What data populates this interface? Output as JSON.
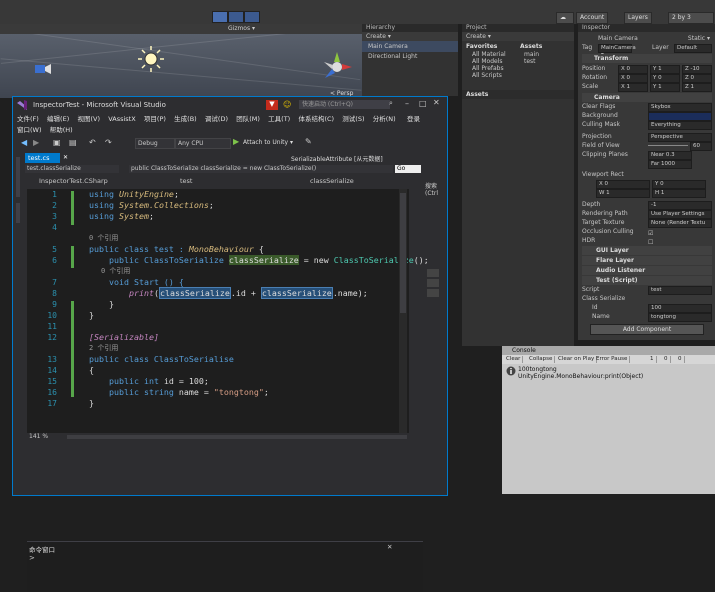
{
  "unity": {
    "top": {
      "account": "Account",
      "layers": "Layers",
      "layout": "2 by 3"
    },
    "scene": {
      "toolbar_label": "Gizmos ▾",
      "persp": "< Persp"
    },
    "hierarchy": {
      "tab": "Hierarchy",
      "create": "Create ▾",
      "search": "Q▾All",
      "items": [
        "Main Camera",
        "Directional Light"
      ]
    },
    "project": {
      "tab": "Project",
      "create": "Create ▾",
      "favorites": "Favorites",
      "fav_items": [
        "All Material",
        "All Models",
        "All Prefabs",
        "All Scripts"
      ],
      "assets_label": "Assets",
      "assets_title": "Assets",
      "assets_items": [
        "main",
        "test"
      ]
    },
    "inspector": {
      "tab": "Inspector",
      "object_name": "Main Camera",
      "static": "Static ▾",
      "tag_label": "Tag",
      "tag_value": "MainCamera ▾",
      "layer_label": "Layer",
      "layer_value": "Default",
      "transform": "Transform",
      "position": {
        "label": "Position",
        "x": "X  0",
        "y": "Y  1",
        "z": "Z  -10"
      },
      "rotation": {
        "label": "Rotation",
        "x": "X  0",
        "y": "Y  0",
        "z": "Z  0"
      },
      "scale": {
        "label": "Scale",
        "x": "X  1",
        "y": "Y  1",
        "z": "Z  1"
      },
      "camera": "Camera",
      "clear_flags": {
        "label": "Clear Flags",
        "value": "Skybox"
      },
      "background": {
        "label": "Background"
      },
      "culling": {
        "label": "Culling Mask",
        "value": "Everything"
      },
      "projection": {
        "label": "Projection",
        "value": "Perspective"
      },
      "fov": {
        "label": "Field of View",
        "value": "60"
      },
      "clipping": {
        "label": "Clipping Planes",
        "near": "Near  0.3",
        "far": "Far   1000"
      },
      "viewport": {
        "label": "Viewport Rect",
        "x": "X  0",
        "y": "Y  0",
        "w": "W  1",
        "h": "H  1"
      },
      "depth": {
        "label": "Depth",
        "value": "-1"
      },
      "rendering_path": {
        "label": "Rendering Path",
        "value": "Use Player Settings"
      },
      "target_texture": {
        "label": "Target Texture",
        "value": "None (Render Textu"
      },
      "occlusion": {
        "label": "Occlusion Culling"
      },
      "hdr": {
        "label": "HDR"
      },
      "gui_layer": "GUI Layer",
      "flare_layer": "Flare Layer",
      "audio_listener": "Audio Listener",
      "test_script": "Test (Script)",
      "script": {
        "label": "Script",
        "value": "test"
      },
      "class_serialize": "Class Serialize",
      "id": {
        "label": "Id",
        "value": "100"
      },
      "name": {
        "label": "Name",
        "value": "tongtong"
      },
      "add_component": "Add Component"
    },
    "console": {
      "tab": "Console",
      "clear": "Clear",
      "collapse": "Collapse",
      "clear_on_play": "Clear on Play",
      "error_pause": "Error Pause",
      "counts": [
        "1",
        "0",
        "0"
      ],
      "log_line1": "100tongtong",
      "log_line2": "UnityEngine.MonoBehaviour:print(Object)"
    }
  },
  "vs": {
    "title": "InspectorTest - Microsoft Visual Studio",
    "quick_launch": "快速启动 (Ctrl+Q)",
    "signin": "登录",
    "menu": [
      "文件(F)",
      "编辑(E)",
      "视图(V)",
      "VAssistX",
      "项目(P)",
      "生成(B)",
      "调试(D)",
      "团队(M)",
      "工具(T)",
      "体系结构(C)",
      "测试(S)",
      "分析(N)"
    ],
    "menu2": [
      "窗口(W)",
      "帮助(H)"
    ],
    "toolbar": {
      "config": "Debug",
      "platform": "Any CPU",
      "attach": "Attach to Unity ▾"
    },
    "tab_file": "test.cs",
    "tab_right": "SerializableAttribute [从元数据]",
    "nav_left": "test.classSerialize",
    "nav_mid": "public ClassToSerialize classSerialize = new ClassToSerialize()",
    "nav_go": "Go",
    "solution_label": "InspectorTest.CSharp",
    "member_left": "test",
    "member_right": "classSerialize",
    "search_panel": "搜索(Ctrl",
    "ref0": "0 个引用",
    "ref0b": "0 个引用",
    "ref2": "2 个引用",
    "line_numbers": [
      "1",
      "2",
      "3",
      "4",
      "5",
      "6",
      "7",
      "8",
      "9",
      "10",
      "11",
      "12",
      "13",
      "14",
      "15",
      "16",
      "17"
    ],
    "code": {
      "using1_kw": "using",
      "using1_ns": "UnityEngine",
      "using2_kw": "using",
      "using2_ns": "System.Collections",
      "using3_kw": "using",
      "using3_ns": "System",
      "class_decl": "public class test : ",
      "mono": "MonoBehaviour",
      "brace": "{",
      "field_a": "public ClassToSerialize ",
      "field_b": "classSerialize",
      "field_c": " = new ",
      "field_d": "ClassToSerialize",
      "field_e": "();",
      "void_start": "void Start () {",
      "print": "print",
      "print_args_a": "(",
      "print_args_b": "classSerialize",
      "print_args_c": ".id + ",
      "print_args_d": "classSerialize",
      "print_args_e": ".name);",
      "close1": "}",
      "close2": "}",
      "attr": "[Serializable]",
      "class2": "public class ClassToSerialise",
      "brace2": "{",
      "id_line_a": "public int ",
      "id_line_b": "id = 100;",
      "name_line_a": "public string ",
      "name_line_b": "name = ",
      "name_str": "\"tongtong\"",
      "name_end": ";",
      "close3": "}"
    },
    "zoom": "141 %",
    "cmd_title": "命令窗口",
    "cmd_prompt": ">"
  }
}
